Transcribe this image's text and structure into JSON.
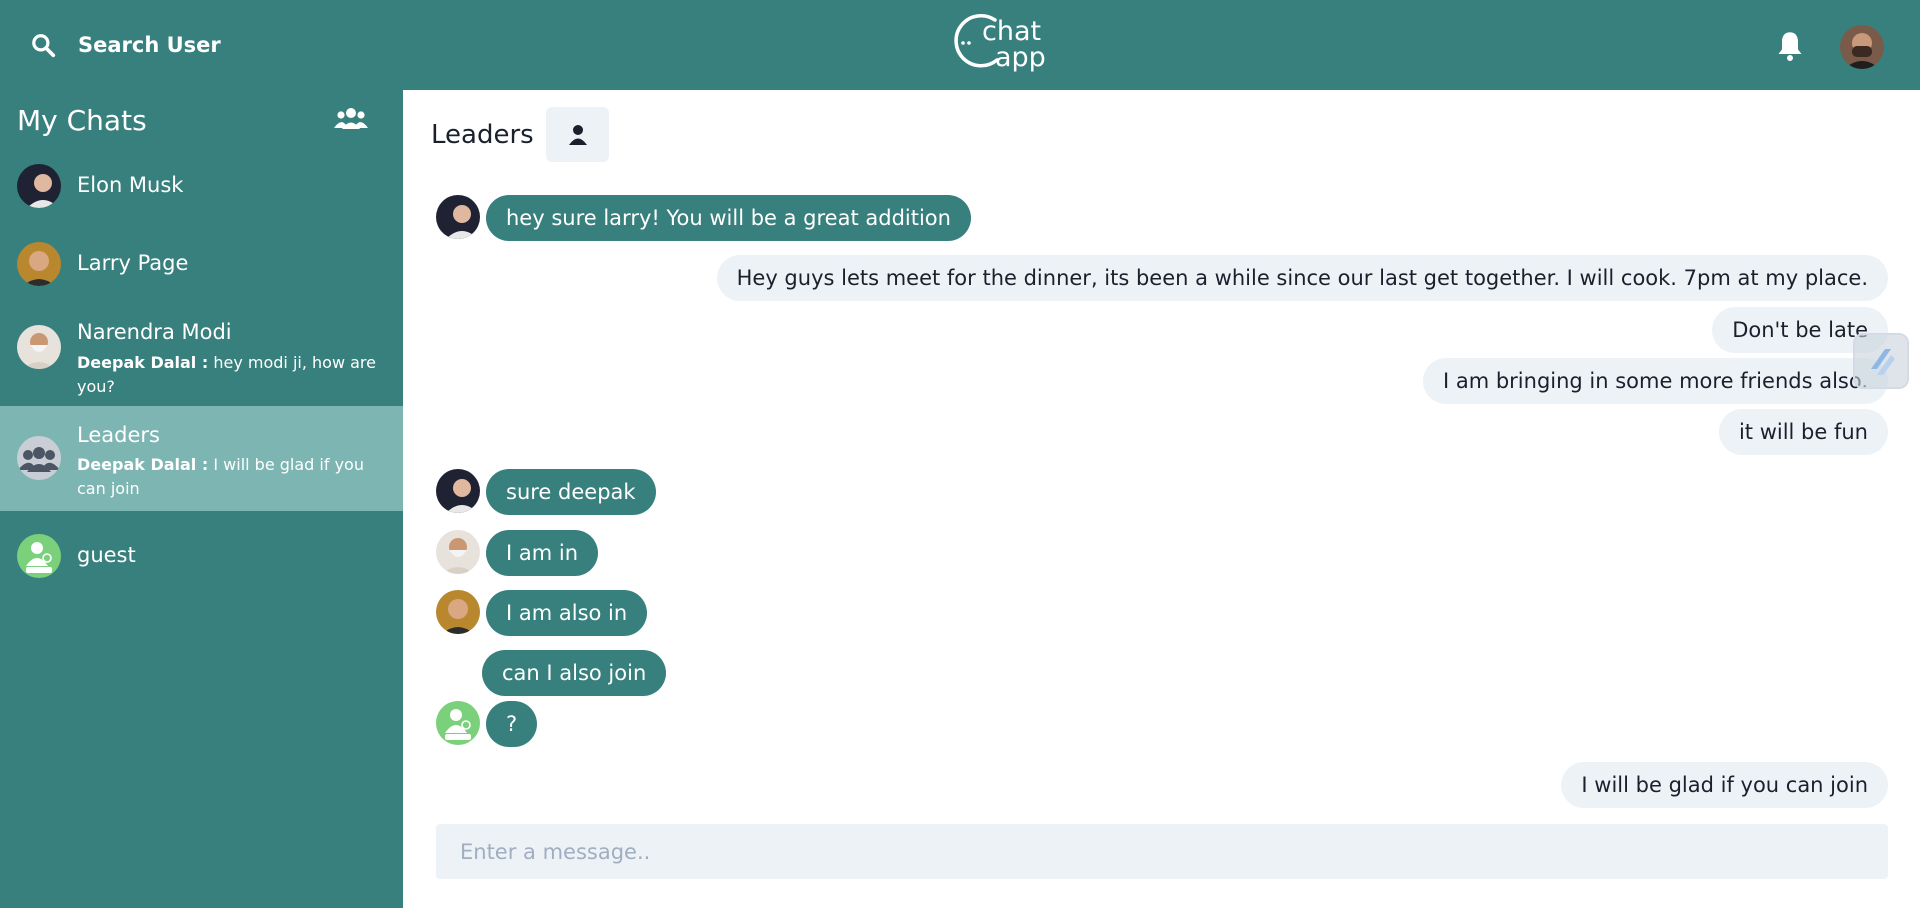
{
  "header": {
    "search_label": "Search User",
    "logo_text_line1": "chat",
    "logo_text_line2": "app",
    "logo_dots": "··"
  },
  "sidebar": {
    "title": "My Chats",
    "chats": [
      {
        "name": "Elon Musk",
        "sender": "",
        "preview": "",
        "active": false
      },
      {
        "name": "Larry Page",
        "sender": "",
        "preview": "",
        "active": false
      },
      {
        "name": "Narendra Modi",
        "sender": "Deepak Dalal :",
        "preview": "hey modi ji, how are you?",
        "active": false
      },
      {
        "name": "Leaders",
        "sender": "Deepak Dalal :",
        "preview": "I will be glad if you can join",
        "active": true
      },
      {
        "name": "guest",
        "sender": "",
        "preview": "",
        "active": false
      }
    ]
  },
  "main": {
    "chat_title": "Leaders",
    "input_placeholder": "Enter a message..",
    "messages": [
      {
        "text": "hey sure larry! You will be a great addition",
        "dir": "in",
        "avatar": "elon"
      },
      {
        "text": "Hey guys lets meet for the dinner, its been a while since our last get together. I will cook. 7pm at my place.",
        "dir": "out"
      },
      {
        "text": "Don't be late",
        "dir": "out"
      },
      {
        "text": "I am bringing in some more friends also.",
        "dir": "out"
      },
      {
        "text": "it will be fun",
        "dir": "out"
      },
      {
        "text": "sure deepak",
        "dir": "in",
        "avatar": "elon"
      },
      {
        "text": "I am in",
        "dir": "in",
        "avatar": "modi"
      },
      {
        "text": "I am also in",
        "dir": "in",
        "avatar": "larry"
      },
      {
        "text": "can I also join",
        "dir": "in",
        "avatar": ""
      },
      {
        "text": "?",
        "dir": "in",
        "avatar": "guest"
      },
      {
        "text": "I will be glad if you can join",
        "dir": "out"
      }
    ]
  },
  "colors": {
    "accent": "#38807d",
    "active_chat": "#7db5b3",
    "bubble_out": "#edf2f7"
  }
}
